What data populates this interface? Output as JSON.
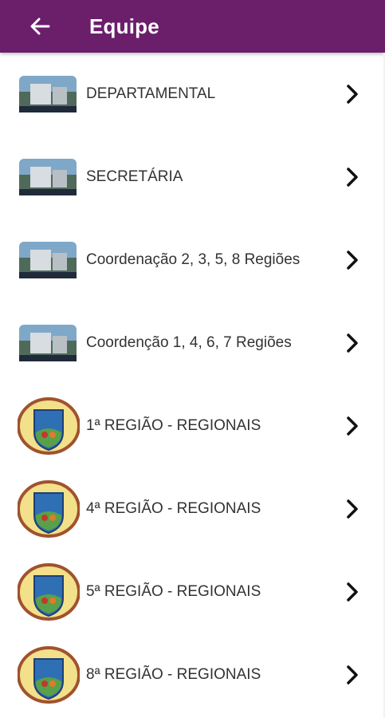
{
  "appbar": {
    "title": "Equipe",
    "back_icon": "arrow-left-icon",
    "color": "#6b1f6b"
  },
  "items": [
    {
      "label": "DEPARTAMENTAL",
      "icon": "building-photo-icon"
    },
    {
      "label": "SECRETÁRIA",
      "icon": "building-photo-icon"
    },
    {
      "label": "Coordenação 2, 3, 5, 8 Regiões",
      "icon": "building-photo-icon"
    },
    {
      "label": "Coordenção 1, 4, 6, 7 Regiões",
      "icon": "building-photo-icon"
    },
    {
      "label": "1ª REGIÃO - REGIONAIS",
      "icon": "region-crest-icon"
    },
    {
      "label": "4ª REGIÃO - REGIONAIS",
      "icon": "region-crest-icon"
    },
    {
      "label": "5ª REGIÃO - REGIONAIS",
      "icon": "region-crest-icon"
    },
    {
      "label": "8ª REGIÃO - REGIONAIS",
      "icon": "region-crest-icon"
    }
  ],
  "chevron_icon": "chevron-right-icon"
}
